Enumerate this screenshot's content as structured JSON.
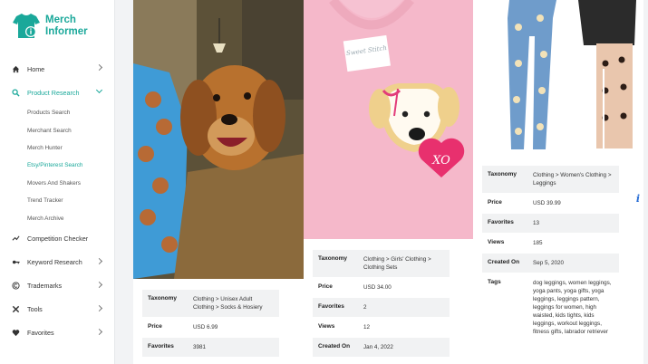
{
  "logo": {
    "line1": "Merch",
    "line2": "Informer"
  },
  "nav": {
    "home": "Home",
    "product_research": "Product Research",
    "sub": [
      "Products Search",
      "Merchant Search",
      "Merch Hunter",
      "Etsy/Pinterest Search",
      "Movers And Shakers",
      "Trend Tracker",
      "Merch Archive"
    ],
    "competition_checker": "Competition Checker",
    "keyword_research": "Keyword Research",
    "trademarks": "Trademarks",
    "tools": "Tools",
    "favorites": "Favorites"
  },
  "products": [
    {
      "rows": [
        {
          "k": "Taxonomy",
          "v": "Clothing > Unisex Adult Clothing > Socks & Hosiery"
        },
        {
          "k": "Price",
          "v": "USD 6.99"
        },
        {
          "k": "Favorites",
          "v": "3981"
        }
      ]
    },
    {
      "brand": "Sweet Stitch",
      "patch_text": "XO",
      "rows": [
        {
          "k": "Taxonomy",
          "v": "Clothing > Girls' Clothing > Clothing Sets"
        },
        {
          "k": "Price",
          "v": "USD 34.00"
        },
        {
          "k": "Favorites",
          "v": "2"
        },
        {
          "k": "Views",
          "v": "12"
        },
        {
          "k": "Created On",
          "v": "Jan 4, 2022"
        }
      ]
    },
    {
      "rows": [
        {
          "k": "Taxonomy",
          "v": "Clothing > Women's Clothing > Leggings"
        },
        {
          "k": "Price",
          "v": "USD 39.99"
        },
        {
          "k": "Favorites",
          "v": "13"
        },
        {
          "k": "Views",
          "v": "185"
        },
        {
          "k": "Created On",
          "v": "Sep 5, 2020"
        },
        {
          "k": "Tags",
          "v": "dog leggings, women leggings, yoga pants, yoga gifts, yoga leggings, leggings pattern, leggings for women, high waisted, kids tights, kids leggings, workout leggings, fitness gifts, labrador retriever"
        }
      ]
    }
  ],
  "info_icon": "i",
  "colors": {
    "accent": "#1aa89a",
    "info": "#2a6fd6"
  }
}
